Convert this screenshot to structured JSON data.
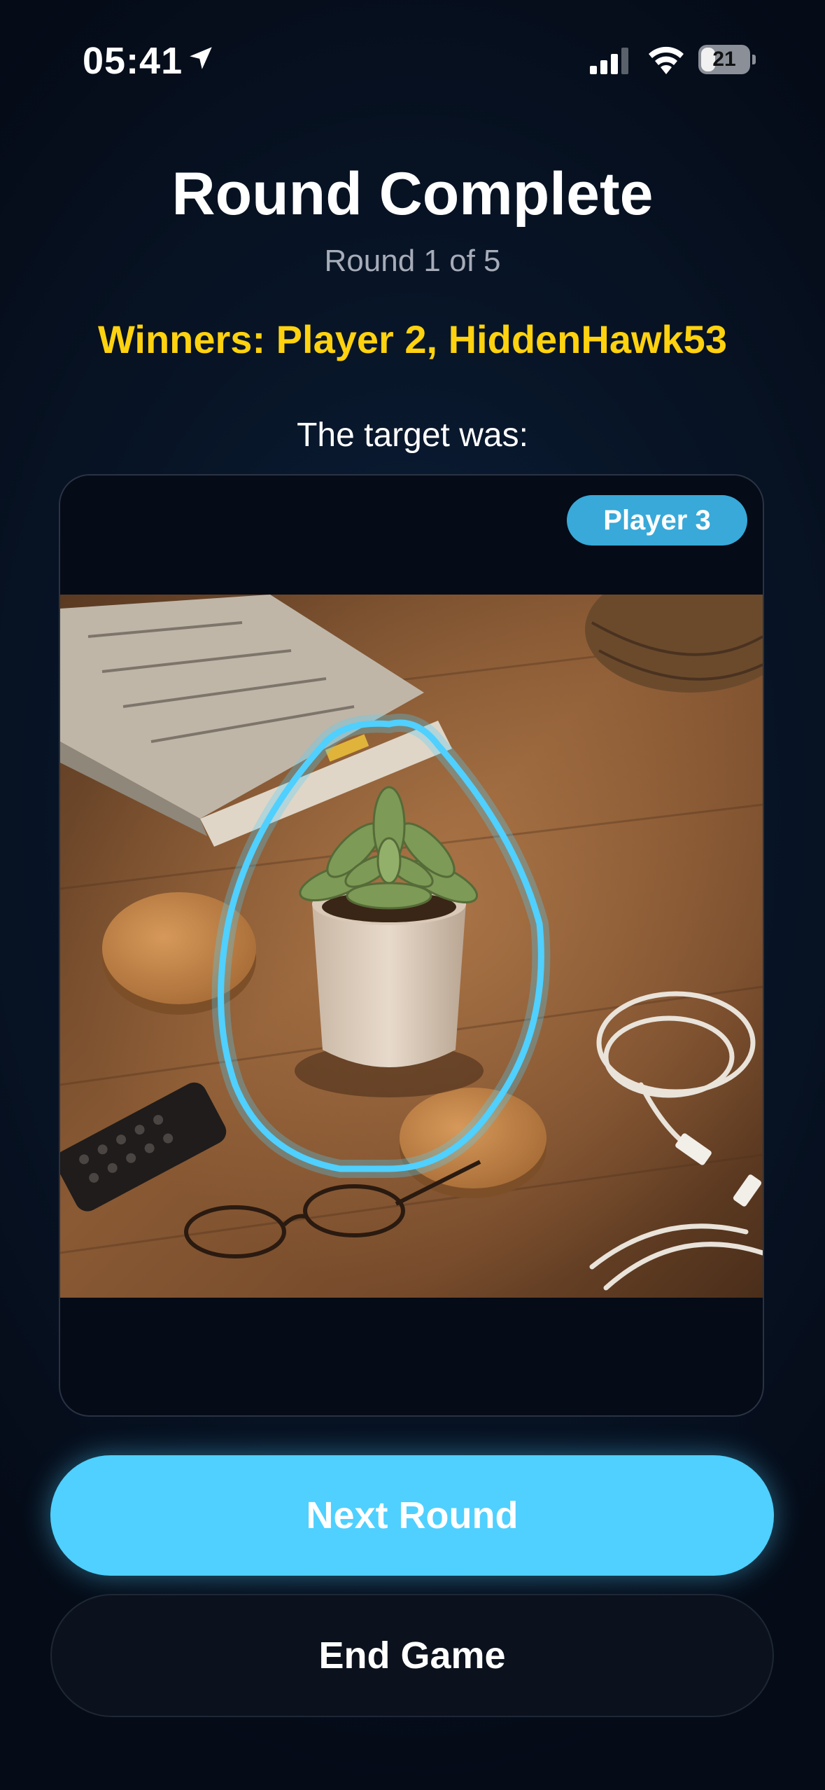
{
  "status_bar": {
    "time": "05:41",
    "battery_level": "21",
    "icons": [
      "location-arrow-icon",
      "cellular-signal-icon",
      "wifi-icon",
      "battery-icon"
    ]
  },
  "header": {
    "title": "Round Complete",
    "round_info": "Round 1 of 5"
  },
  "result": {
    "winners_text": "Winners: Player 2, HiddenHawk53",
    "target_label": "The target was:"
  },
  "target_card": {
    "player_badge": "Player 3",
    "highlight_color": "#4fd0ff"
  },
  "actions": {
    "next_round_label": "Next Round",
    "end_game_label": "End Game"
  },
  "colors": {
    "accent": "#4fd0ff",
    "winners": "#ffd20f",
    "badge": "#38a9d8",
    "background": "#081629"
  }
}
